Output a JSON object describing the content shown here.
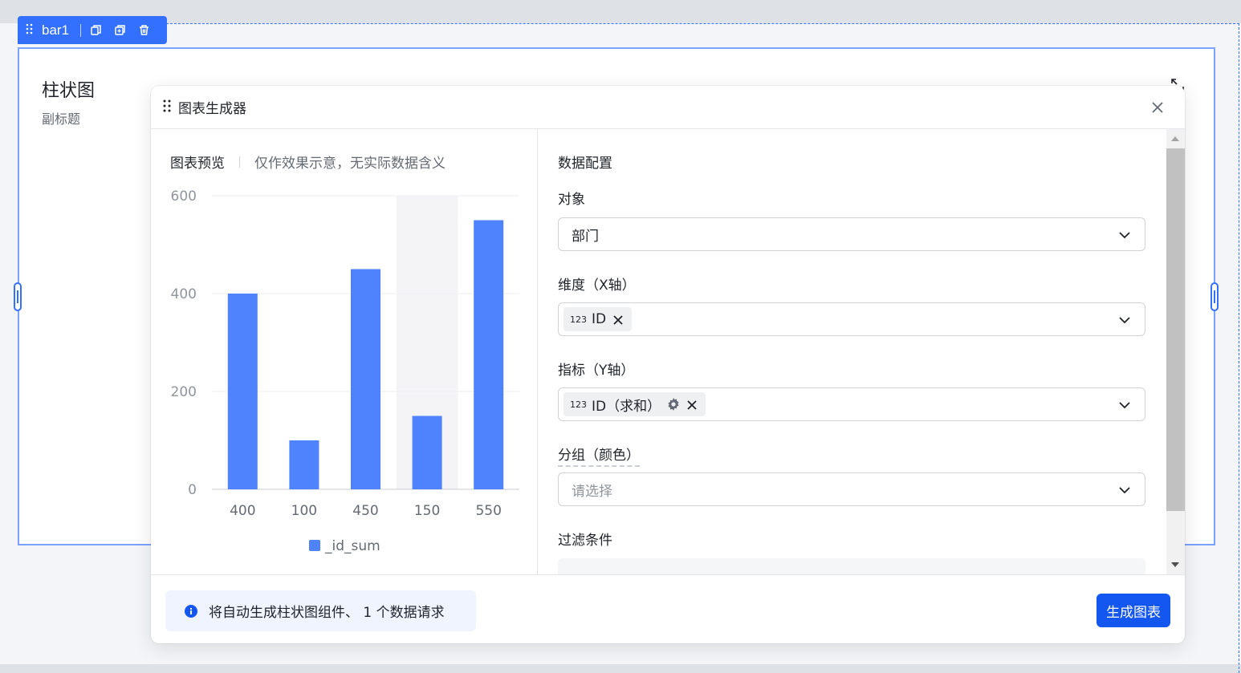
{
  "component": {
    "tag_name": "bar1",
    "title": "柱状图",
    "subtitle": "副标题"
  },
  "dialog": {
    "title": "图表生成器",
    "preview": {
      "label": "图表预览",
      "note": "仅作效果示意，无实际数据含义"
    },
    "config": {
      "section_title": "数据配置",
      "object_label": "对象",
      "object_value": "部门",
      "dimension_label": "维度（X轴）",
      "dimension_chip": "ID",
      "metric_label": "指标（Y轴）",
      "metric_chip": "ID（求和）",
      "group_label": "分组（颜色）",
      "group_placeholder": "请选择",
      "filter_label": "过滤条件",
      "chip_type_badge": "123"
    },
    "footer": {
      "info_text": "将自动生成柱状图组件、 1 个数据请求",
      "generate_label": "生成图表"
    }
  },
  "colors": {
    "accent": "#3370ff",
    "bar": "#4e83fd",
    "primary_button": "#1456f0"
  },
  "icons": {
    "tag": [
      "drag-handle-icon",
      "copy-icon",
      "duplicate-icon",
      "delete-icon"
    ],
    "component": "expand-icon",
    "dialog_close": "close-icon",
    "select_arrow": "chevron-down-icon",
    "chip_remove": "close-icon",
    "chip_settings": "gear-icon",
    "info": "info-icon"
  },
  "chart_data": {
    "type": "bar",
    "categories": [
      "400",
      "100",
      "450",
      "150",
      "550"
    ],
    "series": [
      {
        "name": "_id_sum",
        "values": [
          400,
          100,
          450,
          150,
          550
        ]
      }
    ],
    "yticks": [
      0,
      200,
      400,
      600
    ],
    "ylim": [
      0,
      600
    ],
    "highlight_index": 3,
    "legend_position": "bottom",
    "grid": true
  }
}
